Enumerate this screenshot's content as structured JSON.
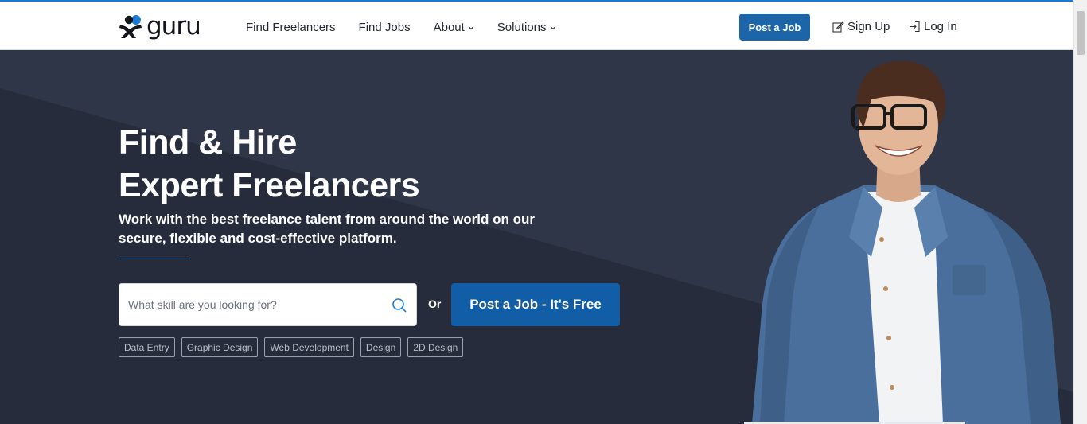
{
  "header": {
    "brand": "guru",
    "nav": [
      {
        "label": "Find Freelancers",
        "has_dropdown": false
      },
      {
        "label": "Find Jobs",
        "has_dropdown": false
      },
      {
        "label": "About",
        "has_dropdown": true
      },
      {
        "label": "Solutions",
        "has_dropdown": true
      }
    ],
    "post_job_label": "Post a Job",
    "signup_label": "Sign Up",
    "login_label": "Log In",
    "icons": {
      "signup": "edit-icon",
      "login": "login-icon",
      "dropdown": "chevron-down-icon"
    }
  },
  "hero": {
    "title_line1": "Find & Hire",
    "title_line2": "Expert Freelancers",
    "subtitle": "Work with the best freelance talent from around the world on our secure, flexible and cost-effective platform.",
    "search": {
      "placeholder": "What skill are you looking for?",
      "value": "",
      "icon": "search-icon"
    },
    "or_label": "Or",
    "cta_label": "Post a Job - It's Free",
    "tags": [
      "Data Entry",
      "Graphic Design",
      "Web Development",
      "Design",
      "2D Design"
    ]
  },
  "colors": {
    "accent": "#1b65a8",
    "cta": "#125ea6",
    "hero_bg": "#2f3648",
    "hero_shade": "#262c3c",
    "header_bg": "#ffffff",
    "top_line": "#1b7ad6"
  }
}
